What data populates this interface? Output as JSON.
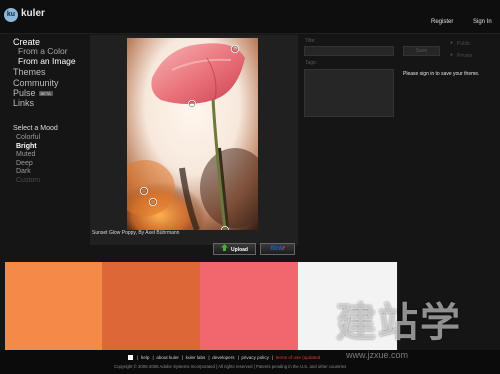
{
  "header": {
    "logo_badge": "ku",
    "logo_text": "kuler",
    "register": "Register",
    "sign_in": "Sign In"
  },
  "nav": {
    "create": "Create",
    "from_color": "From a Color",
    "from_image": "From an Image",
    "themes": "Themes",
    "community": "Community",
    "pulse": "Pulse",
    "pulse_badge": "BETA",
    "links": "Links"
  },
  "mood": {
    "heading": "Select a Mood",
    "options": [
      "Colorful",
      "Bright",
      "Muted",
      "Deep",
      "Dark",
      "Custom"
    ],
    "selected": "Bright"
  },
  "image": {
    "caption": "Sunset Glow Poppy, By Axel Bührmann",
    "upload_label": "Upload",
    "flickr_label": "flickr"
  },
  "form": {
    "title_label": "Title:",
    "tags_label": "Tags:",
    "save_label": "Save",
    "public_label": "Public",
    "private_label": "Private",
    "signin_msg": "Please sign in to save your theme."
  },
  "swatches": [
    {
      "name": "swatch-1",
      "color": "#F38A47"
    },
    {
      "name": "swatch-2",
      "color": "#DE6738"
    },
    {
      "name": "swatch-3",
      "color": "#F2676E"
    },
    {
      "name": "swatch-4",
      "color": "#F3F3F3"
    },
    {
      "name": "swatch-5",
      "color": "#1E1E1E"
    }
  ],
  "footer": {
    "links": [
      "help",
      "about kuler",
      "kuler labs",
      "developers",
      "privacy policy",
      "terms of use (updated"
    ],
    "copyright": "Copyright © 2006-2008 Adobe Systems Incorporated | All rights reserved | Patents pending in the U.S. and other countries"
  },
  "watermark": {
    "cjk": "建站学",
    "url": "www.jzxue.com"
  },
  "colors": {
    "background": "#151515",
    "terms_link": "#e23b2e",
    "upload_arrow": "#4caf3a",
    "flickr_blue": "#1f61d6",
    "flickr_pink": "#ff2d8e"
  }
}
